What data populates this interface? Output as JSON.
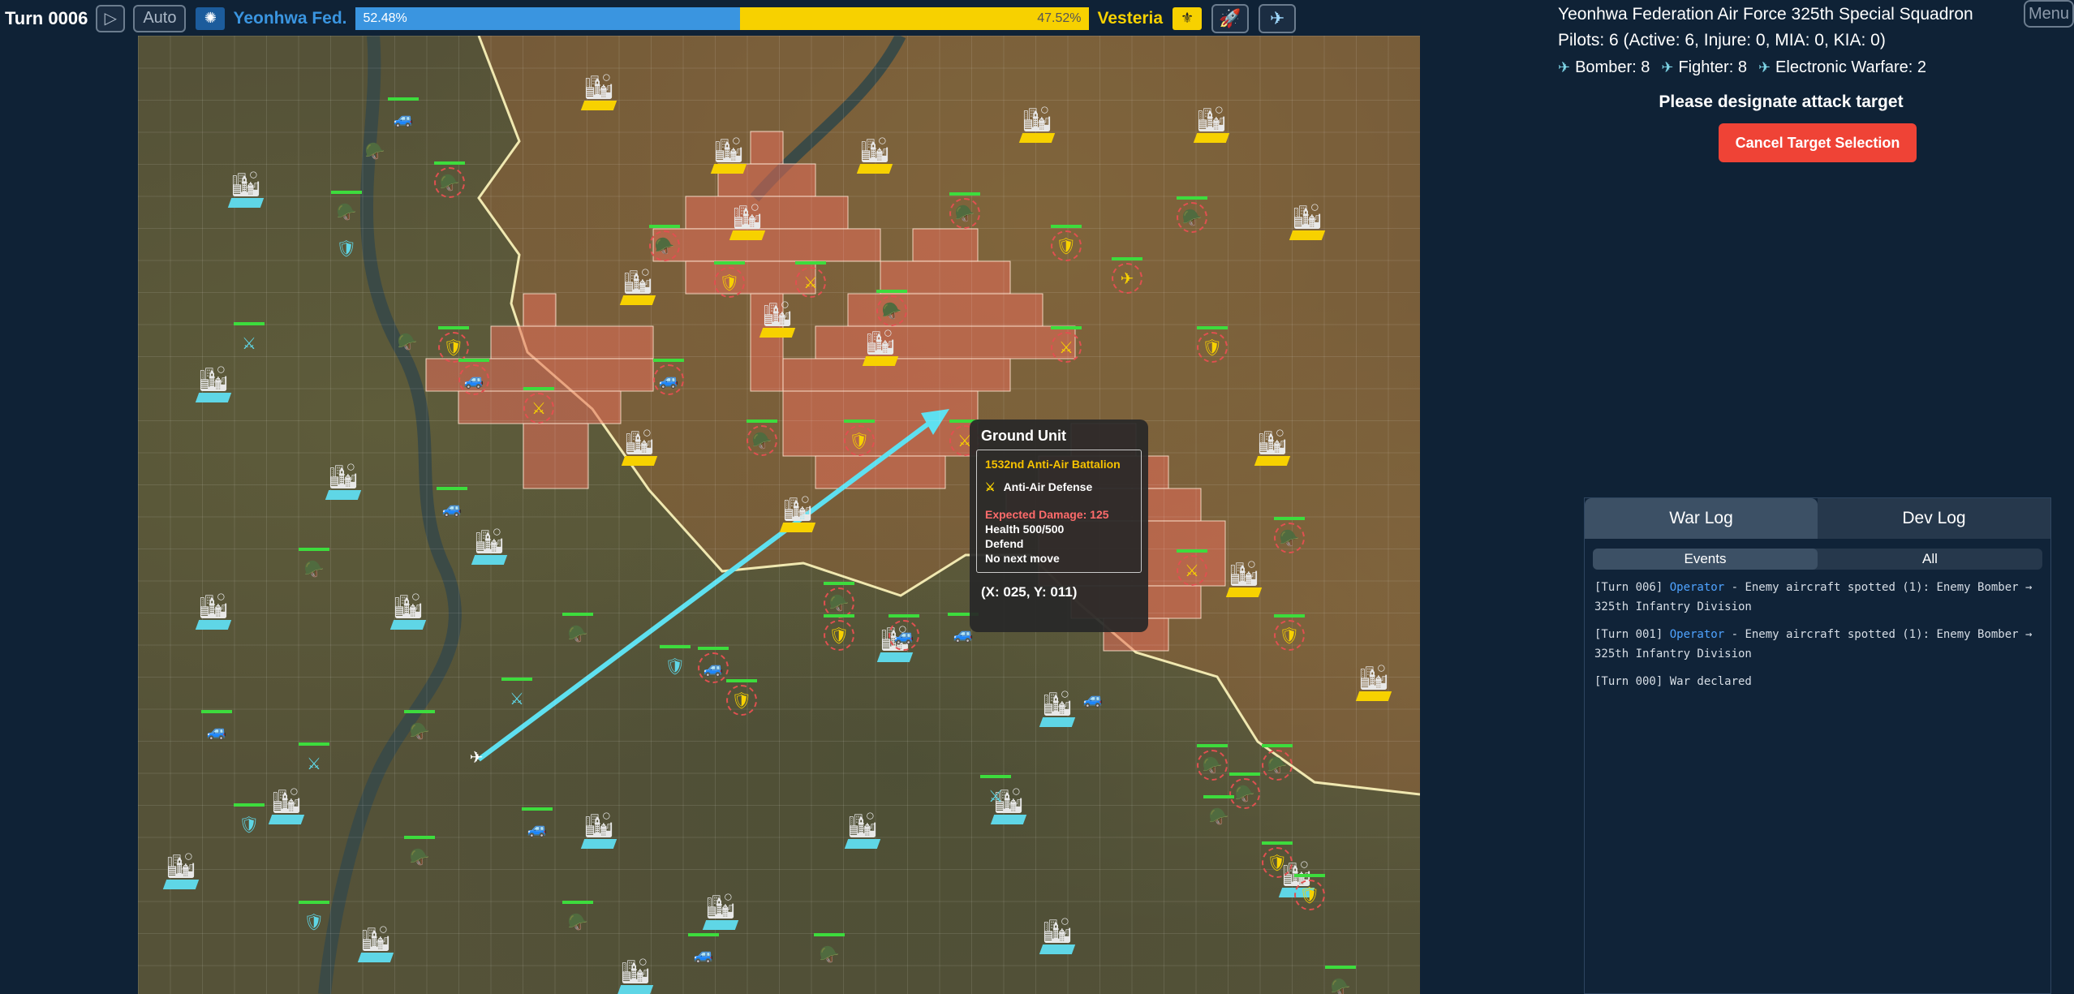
{
  "topbar": {
    "turn": "Turn 0006",
    "play_icon": "play-icon",
    "auto_label": "Auto",
    "left_faction": "Yeonhwa Fed.",
    "left_percent": "52.48%",
    "left_share": 0.5248,
    "right_faction": "Vesteria",
    "right_percent": "47.52%",
    "left_color": "#3a95e0",
    "right_color": "#f7d100",
    "missile_icon": "missile-icon",
    "aircraft_icon": "aircraft-icon"
  },
  "panel": {
    "squadron_title": "Yeonhwa Federation Air Force 325th Special Squadron",
    "pilots": "Pilots: 6 (Active: 6, Injure: 0, MIA: 0, KIA: 0)",
    "aircraft": [
      {
        "label": "Bomber: 8",
        "icon": "bomber-icon"
      },
      {
        "label": "Fighter: 8",
        "icon": "fighter-icon"
      },
      {
        "label": "Electronic Warfare: 2",
        "icon": "ew-aircraft-icon"
      }
    ],
    "menu_label": "Menu",
    "prompt": "Please designate attack target",
    "cancel_label": "Cancel Target Selection",
    "cancel_color": "#ef4336"
  },
  "log": {
    "tabs": [
      "War Log",
      "Dev Log"
    ],
    "subtabs": [
      "Events",
      "All"
    ],
    "entries": [
      {
        "prefix": "[Turn 006] ",
        "actor": "Operator",
        "text": " - Enemy aircraft spotted (1): Enemy Bomber → 325th Infantry Division"
      },
      {
        "prefix": "[Turn 001] ",
        "actor": "Operator",
        "text": " - Enemy aircraft spotted (1): Enemy Bomber → 325th Infantry Division"
      },
      {
        "prefix": "[Turn 000] War declared",
        "actor": "",
        "text": ""
      }
    ]
  },
  "tooltip": {
    "title": "Ground Unit",
    "unit_name": "1532nd Anti-Air Battalion",
    "unit_type": "Anti-Air Defense",
    "unit_icon": "anti-air-icon",
    "expected_damage": "Expected Damage: 125",
    "health": "Health 500/500",
    "stance": "Defend",
    "next_move": "No next move",
    "coords": "(X: 025, Y: 011)"
  }
}
